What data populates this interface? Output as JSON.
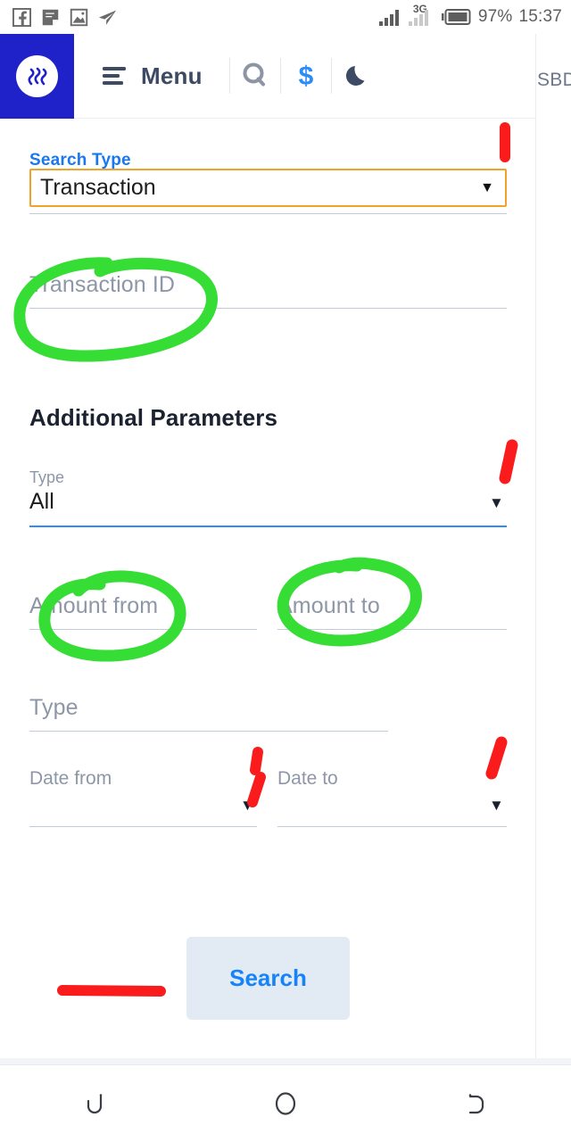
{
  "status_bar": {
    "left_icons": [
      "facebook-icon",
      "note-icon",
      "gallery-icon",
      "telegram-icon"
    ],
    "network_label": "3G",
    "battery_percent": "97%",
    "time": "15:37"
  },
  "header": {
    "logo": "steem-logo-icon",
    "menu_label": "Menu",
    "icons": [
      "search-icon",
      "dollar-icon",
      "moon-icon"
    ],
    "currency_label": "SBD"
  },
  "form": {
    "search_type": {
      "label": "Search Type",
      "value": "Transaction",
      "caret": "▼"
    },
    "transaction_id": {
      "placeholder": "Transaction ID",
      "value": ""
    },
    "additional_parameters_title": "Additional Parameters",
    "type_select": {
      "label": "Type",
      "value": "All",
      "caret": "▼"
    },
    "amount_from": {
      "placeholder": "Amount from",
      "value": ""
    },
    "amount_to": {
      "placeholder": "Amount to",
      "value": ""
    },
    "type_text": {
      "placeholder": "Type",
      "value": ""
    },
    "date_from": {
      "placeholder": "Date from",
      "value": "",
      "caret": "▼"
    },
    "date_to": {
      "placeholder": "Date to",
      "value": "",
      "caret": "▼"
    },
    "search_button_label": "Search"
  },
  "annotations": {
    "green_color": "#35dd35",
    "red_color": "#fa1c1c",
    "shapes": [
      "green-circle-transaction-id",
      "green-circle-amount-from",
      "green-circle-amount-to",
      "red-mark-search-type",
      "red-mark-type-select",
      "red-mark-date-from",
      "red-mark-date-to",
      "red-line-search-button"
    ]
  },
  "nav_bar": {
    "buttons": [
      "back-icon",
      "home-icon",
      "recents-icon"
    ]
  },
  "colors": {
    "brand_blue": "#2022c9",
    "accent_blue": "#1978f0",
    "select_border": "#f0a32a",
    "underline": "#c3cbd8",
    "focus_underline": "#2f8bf7",
    "button_bg": "#e2ebf3"
  }
}
